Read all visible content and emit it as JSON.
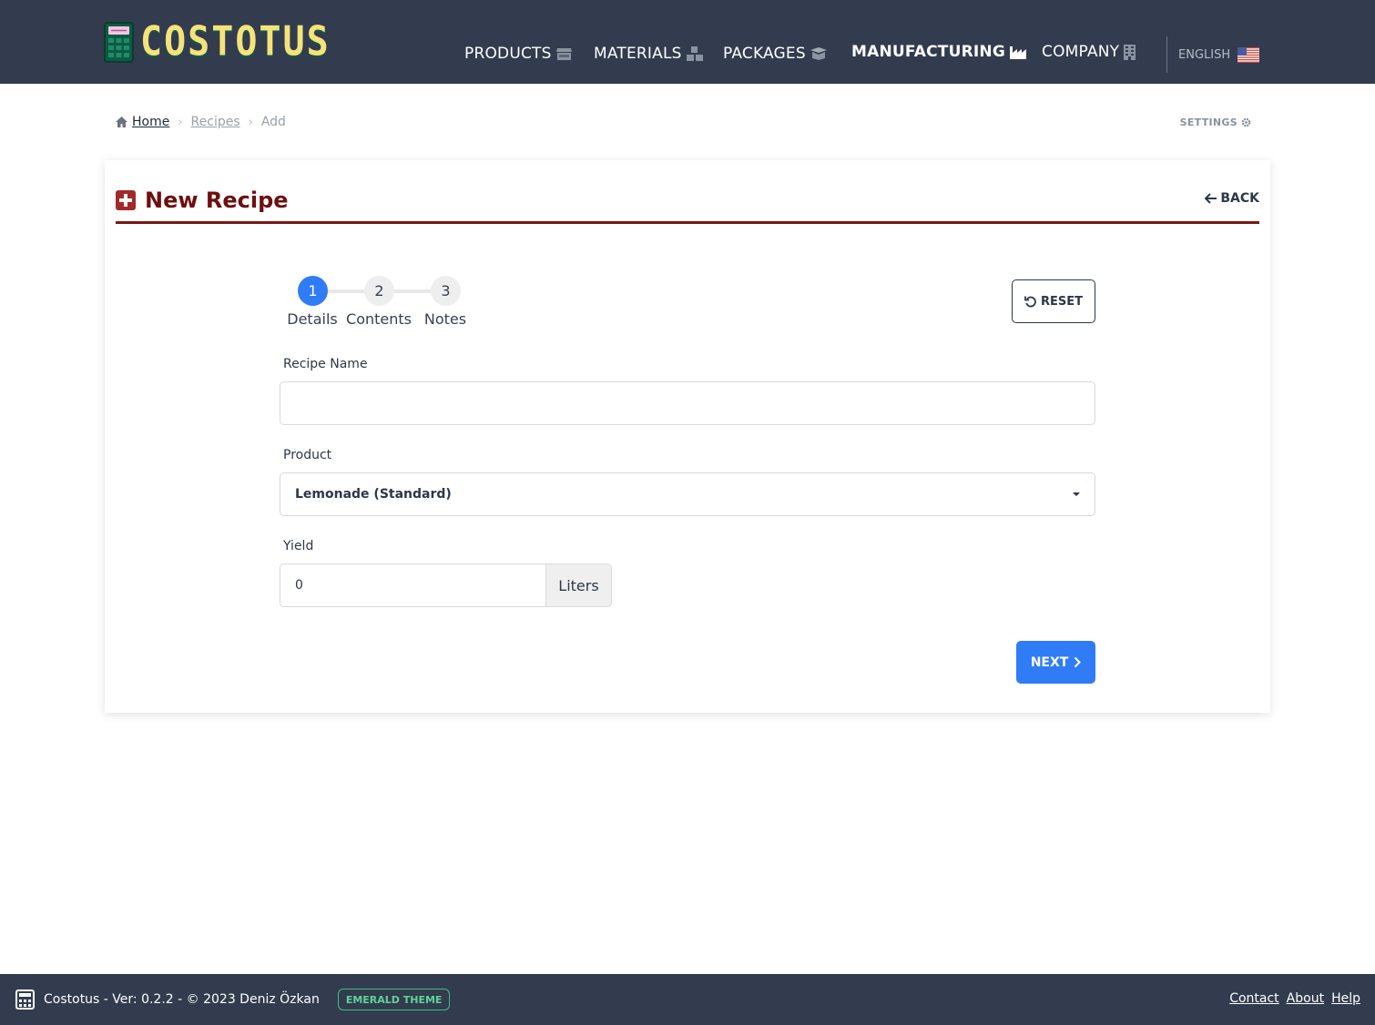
{
  "app": {
    "logo_text": "COSTOTUS",
    "logo_icon": "calculator-icon"
  },
  "nav": {
    "items": [
      {
        "label": "PRODUCTS",
        "icon": "store-icon",
        "active": false
      },
      {
        "label": "MATERIALS",
        "icon": "boxes-icon",
        "active": false
      },
      {
        "label": "PACKAGES",
        "icon": "box-open-icon",
        "active": false
      },
      {
        "label": "MANUFACTURING",
        "icon": "industry-icon",
        "active": true
      },
      {
        "label": "COMPANY",
        "icon": "building-icon",
        "active": false
      }
    ],
    "language": "ENGLISH",
    "language_icon": "us-flag-icon"
  },
  "breadcrumb": {
    "home": "Home",
    "recipes": "Recipes",
    "current": "Add"
  },
  "settings_label": "SETTINGS",
  "card": {
    "title": "New Recipe",
    "back_label": "BACK"
  },
  "stepper": {
    "steps": [
      {
        "number": "1",
        "label": "Details",
        "active": true
      },
      {
        "number": "2",
        "label": "Contents",
        "active": false
      },
      {
        "number": "3",
        "label": "Notes",
        "active": false
      }
    ]
  },
  "reset_label": "RESET",
  "form": {
    "recipe_name": {
      "label": "Recipe Name",
      "value": ""
    },
    "product": {
      "label": "Product",
      "selected": "Lemonade (Standard)"
    },
    "yield": {
      "label": "Yield",
      "value": "0",
      "unit": "Liters"
    }
  },
  "next_label": "NEXT",
  "footer": {
    "copyright": "Costotus - Ver: 0.2.2 - © 2023 Deniz Özkan",
    "theme_badge": "EMERALD THEME",
    "links": [
      "Contact",
      "About",
      "Help"
    ]
  },
  "colors": {
    "header_bg": "#323c4e",
    "accent_blue": "#2f7cf6",
    "title_red": "#6e0f0f",
    "logo_yellow": "#f5e27a",
    "theme_green": "#3fbf7f"
  }
}
